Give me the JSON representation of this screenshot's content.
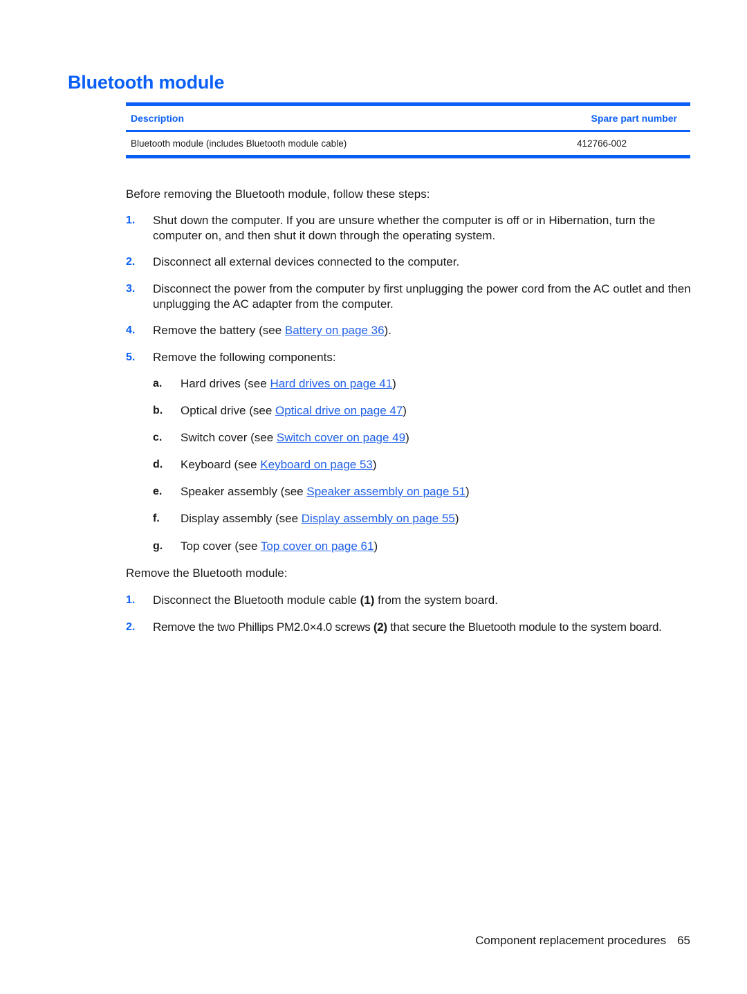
{
  "page": {
    "title": "Bluetooth module",
    "accent_color": "#0a5ff5",
    "link_color": "#1f5fe8"
  },
  "table": {
    "headers": {
      "description": "Description",
      "spare_part_number": "Spare part number"
    },
    "rows": [
      {
        "description": "Bluetooth module (includes Bluetooth module cable)",
        "spare_part_number": "412766-002"
      }
    ]
  },
  "before": {
    "intro": "Before removing the Bluetooth module, follow these steps:",
    "steps": [
      {
        "num": "1.",
        "text": "Shut down the computer. If you are unsure whether the computer is off or in Hibernation, turn the computer on, and then shut it down through the operating system."
      },
      {
        "num": "2.",
        "text": "Disconnect all external devices connected to the computer."
      },
      {
        "num": "3.",
        "text": "Disconnect the power from the computer by first unplugging the power cord from the AC outlet and then unplugging the AC adapter from the computer."
      },
      {
        "num": "4.",
        "pre": "Remove the battery (see ",
        "link": "Battery on page 36",
        "post": ")."
      },
      {
        "num": "5.",
        "text": "Remove the following components:"
      }
    ],
    "substeps": [
      {
        "letter": "a.",
        "pre": "Hard drives (see ",
        "link": "Hard drives on page 41",
        "post": ")"
      },
      {
        "letter": "b.",
        "pre": "Optical drive (see ",
        "link": "Optical drive on page 47",
        "post": ")"
      },
      {
        "letter": "c.",
        "pre": "Switch cover (see ",
        "link": "Switch cover on page 49",
        "post": ")"
      },
      {
        "letter": "d.",
        "pre": "Keyboard (see ",
        "link": "Keyboard on page 53",
        "post": ")"
      },
      {
        "letter": "e.",
        "pre": "Speaker assembly (see ",
        "link": "Speaker assembly on page 51",
        "post": ")"
      },
      {
        "letter": "f.",
        "pre": "Display assembly (see ",
        "link": "Display assembly on page 55",
        "post": ")"
      },
      {
        "letter": "g.",
        "pre": "Top cover (see ",
        "link": "Top cover on page 61",
        "post": ")"
      }
    ]
  },
  "remove": {
    "intro": "Remove the Bluetooth module:",
    "steps": [
      {
        "num": "1.",
        "pre": "Disconnect the Bluetooth module cable ",
        "callout": "(1)",
        "post": " from the system board."
      },
      {
        "num": "2.",
        "pre": "Remove the two Phillips PM2.0×4.0 screws ",
        "callout": "(2)",
        "post": " that secure the Bluetooth module to the system board."
      }
    ]
  },
  "footer": {
    "section": "Component replacement procedures",
    "page_number": "65"
  }
}
